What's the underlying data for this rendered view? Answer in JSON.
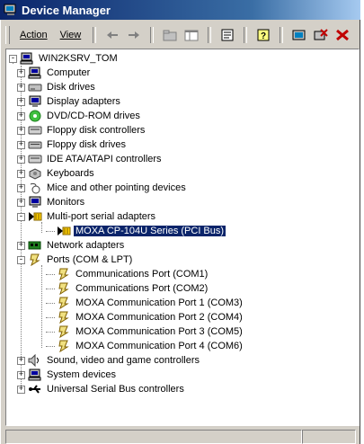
{
  "window": {
    "title": "Device Manager"
  },
  "menu": {
    "action": "Action",
    "view": "View"
  },
  "tree": {
    "root": "WIN2KSRV_TOM",
    "items": [
      {
        "label": "Computer",
        "icon": "computer-icon",
        "expander": "+"
      },
      {
        "label": "Disk drives",
        "icon": "disk-drive-icon",
        "expander": "+"
      },
      {
        "label": "Display adapters",
        "icon": "display-adapter-icon",
        "expander": "+"
      },
      {
        "label": "DVD/CD-ROM drives",
        "icon": "cdrom-icon",
        "expander": "+"
      },
      {
        "label": "Floppy disk controllers",
        "icon": "floppy-controller-icon",
        "expander": "+"
      },
      {
        "label": "Floppy disk drives",
        "icon": "floppy-drive-icon",
        "expander": "+"
      },
      {
        "label": "IDE ATA/ATAPI controllers",
        "icon": "ide-controller-icon",
        "expander": "+"
      },
      {
        "label": "Keyboards",
        "icon": "keyboard-icon",
        "expander": "+"
      },
      {
        "label": "Mice and other pointing devices",
        "icon": "mouse-icon",
        "expander": "+"
      },
      {
        "label": "Monitors",
        "icon": "monitor-icon",
        "expander": "+"
      },
      {
        "label": "Multi-port serial adapters",
        "icon": "serial-adapter-icon",
        "expander": "-"
      },
      {
        "label": "MOXA CP-104U Series (PCI Bus)",
        "icon": "serial-adapter-icon",
        "child": true,
        "selected": true
      },
      {
        "label": "Network adapters",
        "icon": "network-adapter-icon",
        "expander": "+"
      },
      {
        "label": "Ports (COM & LPT)",
        "icon": "port-icon",
        "expander": "-"
      },
      {
        "label": "Communications Port (COM1)",
        "icon": "port-icon",
        "child": true
      },
      {
        "label": "Communications Port (COM2)",
        "icon": "port-icon",
        "child": true
      },
      {
        "label": "MOXA Communication Port 1 (COM3)",
        "icon": "port-icon",
        "child": true
      },
      {
        "label": "MOXA Communication Port 2 (COM4)",
        "icon": "port-icon",
        "child": true
      },
      {
        "label": "MOXA Communication Port 3 (COM5)",
        "icon": "port-icon",
        "child": true
      },
      {
        "label": "MOXA Communication Port 4 (COM6)",
        "icon": "port-icon",
        "child": true
      },
      {
        "label": "Sound, video and game controllers",
        "icon": "sound-icon",
        "expander": "+"
      },
      {
        "label": "System devices",
        "icon": "system-icon",
        "expander": "+"
      },
      {
        "label": "Universal Serial Bus controllers",
        "icon": "usb-icon",
        "expander": "+"
      }
    ]
  },
  "toolbar": {
    "buttons": [
      "back-arrow-icon",
      "forward-arrow-icon",
      "up-folder-icon",
      "show-hide-tree-icon",
      "properties-icon",
      "help-icon",
      "scan-hardware-icon",
      "uninstall-icon",
      "disable-icon"
    ]
  },
  "colors": {
    "title_bar": "#0a246a",
    "selection": "#0a246a",
    "window_face": "#d4d0c8"
  }
}
